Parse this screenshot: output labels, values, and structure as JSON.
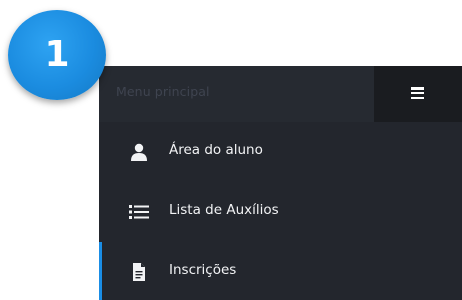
{
  "step_badge": {
    "number": "1",
    "color": "#1b8ce0"
  },
  "menu": {
    "title": "Menu principal",
    "toggle_icon": "hamburger-icon",
    "items": [
      {
        "label": "Área do aluno",
        "icon": "user-icon",
        "active": false
      },
      {
        "label": "Lista de Auxílios",
        "icon": "list-icon",
        "active": false
      },
      {
        "label": "Inscrições",
        "icon": "document-icon",
        "active": true
      }
    ]
  },
  "colors": {
    "panel_bg": "#23262d",
    "toggle_bg": "#1a1c20",
    "active_accent": "#1a8de5",
    "text": "#f2f3f5"
  }
}
